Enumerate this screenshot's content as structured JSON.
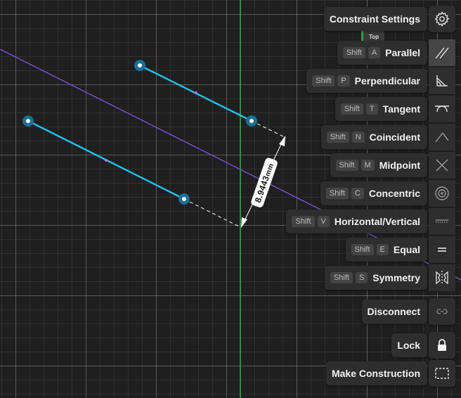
{
  "dimension": {
    "value": "8.9443",
    "unit": "mm"
  },
  "view_chip": {
    "label": "Top"
  },
  "settings": {
    "label": "Constraint Settings",
    "icon": "gear-icon"
  },
  "constraints": [
    {
      "id": "parallel",
      "mod": "Shift",
      "key": "A",
      "label": "Parallel",
      "icon": "parallel-icon",
      "active": true
    },
    {
      "id": "perpendicular",
      "mod": "Shift",
      "key": "P",
      "label": "Perpendicular",
      "icon": "perpendicular-icon"
    },
    {
      "id": "tangent",
      "mod": "Shift",
      "key": "T",
      "label": "Tangent",
      "icon": "tangent-icon"
    },
    {
      "id": "coincident",
      "mod": "Shift",
      "key": "N",
      "label": "Coincident",
      "icon": "coincident-icon"
    },
    {
      "id": "midpoint",
      "mod": "Shift",
      "key": "M",
      "label": "Midpoint",
      "icon": "midpoint-icon"
    },
    {
      "id": "concentric",
      "mod": "Shift",
      "key": "C",
      "label": "Concentric",
      "icon": "concentric-icon"
    },
    {
      "id": "horizontal-vertical",
      "mod": "Shift",
      "key": "V",
      "label": "Horizontal/Vertical",
      "icon": "horizontal-vertical-icon"
    },
    {
      "id": "equal",
      "mod": "Shift",
      "key": "E",
      "label": "Equal",
      "icon": "equal-icon"
    },
    {
      "id": "symmetry",
      "mod": "Shift",
      "key": "S",
      "label": "Symmetry",
      "icon": "symmetry-icon"
    }
  ],
  "actions": [
    {
      "id": "disconnect",
      "label": "Disconnect",
      "icon": "disconnect-icon"
    },
    {
      "id": "lock",
      "label": "Lock",
      "icon": "lock-icon"
    },
    {
      "id": "make-construction",
      "label": "Make Construction",
      "icon": "construction-icon"
    }
  ],
  "colors": {
    "segment": "#22c1ee",
    "construction_line": "#8a4ee8",
    "axis": "#3fae57",
    "endpoint": "#1b6f94"
  }
}
